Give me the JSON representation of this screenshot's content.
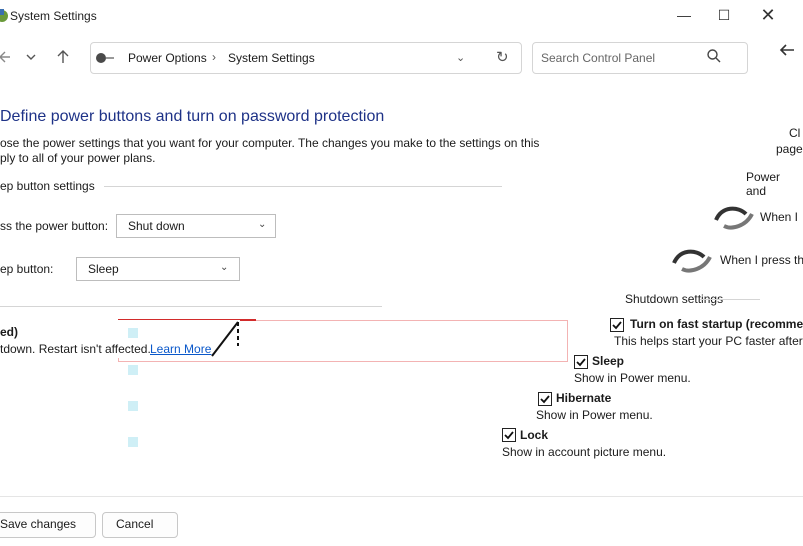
{
  "window": {
    "title": "System Settings",
    "minimize_glyph": "—",
    "maximize_glyph": "☐",
    "close_glyph": "✕"
  },
  "address_bar": {
    "breadcrumb": [
      "Power Options",
      "System Settings"
    ],
    "separator": "›",
    "dropdown_glyph": "⌄",
    "refresh_glyph": "↻"
  },
  "search": {
    "placeholder": "Search Control Panel"
  },
  "page": {
    "title": "Define power buttons and turn on password protection",
    "description_line1": "ose the power settings that you want for your computer. The changes you make to the settings on this",
    "description_line2": "ply to all of your power plans.",
    "section_label": "ep button settings",
    "power_button_label": "ss the power button:",
    "power_button_value": "Shut down",
    "sleep_button_label": "ep button:",
    "sleep_button_value": "Sleep",
    "select_chevron": "⌄"
  },
  "highlight": {
    "label_fragment": "ed)",
    "text_fragment": "tdown. Restart isn't affected.",
    "learn_more": "Learn More"
  },
  "right_panel": {
    "frag1": "Cl",
    "frag2": "page",
    "frag3": "Power and",
    "frag4": "When I",
    "frag5": "When I press the",
    "shutdown_settings": "Shutdown settings",
    "checkboxes": [
      {
        "label": "Turn on fast startup (recommen",
        "desc": "This helps start your PC faster after s",
        "checked": true
      },
      {
        "label": "Sleep",
        "desc": "Show in Power menu.",
        "checked": true
      },
      {
        "label": "Hibernate",
        "desc": "Show in Power menu.",
        "checked": true
      },
      {
        "label": "Lock",
        "desc": "Show in account picture menu.",
        "checked": true
      }
    ]
  },
  "footer": {
    "save_label": "Save changes",
    "cancel_label": "Cancel"
  },
  "colors": {
    "title_blue": "#1e3287",
    "link_blue": "#0a58ca",
    "highlight_red": "#d22b2b"
  },
  "icons": [
    "power-options-icon",
    "shield-swirl-icon",
    "search-icon",
    "back-arrow-icon",
    "chevron-down-icon",
    "refresh-icon"
  ]
}
